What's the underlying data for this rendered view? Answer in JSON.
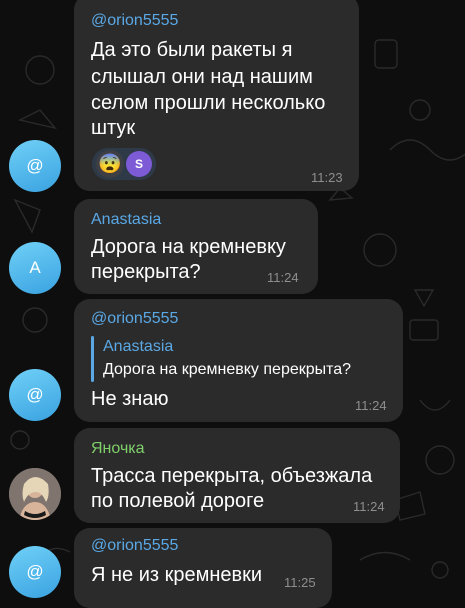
{
  "colors": {
    "background": "#0e0e0e",
    "bubble": "#2b2b2b",
    "name_blue": "#5aa8e6",
    "name_green": "#7fd06a",
    "time": "#8e8e8e",
    "avatar_gradient_top": "#6fd0f7",
    "avatar_gradient_bottom": "#3aa2e0"
  },
  "messages": [
    {
      "sender": "@orion5555",
      "lines": [
        "Да это были ракеты я",
        "слышал они над нашим",
        "селом прошли несколько",
        "штук"
      ],
      "reaction_emoji": "😨",
      "reaction_badge": "S",
      "time": "11:23",
      "avatar": "@"
    },
    {
      "sender": "Anastasia",
      "lines": [
        "Дорога на кремневку",
        "перекрыта?"
      ],
      "time": "11:24",
      "avatar": "A"
    },
    {
      "sender": "@orion5555",
      "reply_sender": "Anastasia",
      "reply_text": "Дорога на кремневку перекрыта?",
      "lines": [
        "Не знаю"
      ],
      "time": "11:24",
      "avatar": "@"
    },
    {
      "sender": "Яночка",
      "lines": [
        "Трасса перекрыта, объезжала",
        "по полевой дороге"
      ],
      "time": "11:24",
      "avatar_icon": "user-photo"
    },
    {
      "sender": "@orion5555",
      "lines": [
        "Я не из кремневки"
      ],
      "time": "11:25",
      "avatar": "@"
    }
  ]
}
